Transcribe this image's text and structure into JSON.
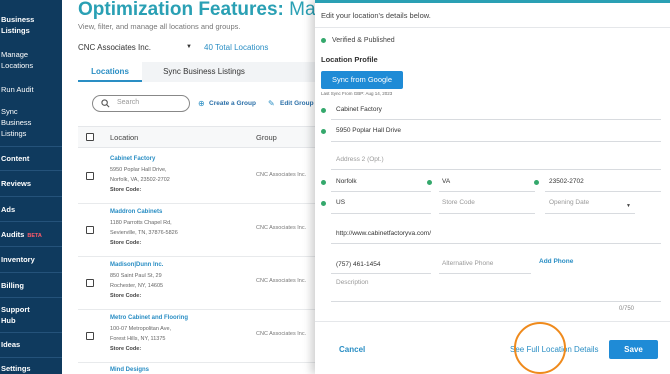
{
  "sidebar": {
    "items": [
      {
        "label": "Business\nListings"
      },
      {
        "label": "Manage\nLocations"
      },
      {
        "label": "Run Audit"
      },
      {
        "label": "Sync\nBusiness\nListings"
      },
      {
        "label": "Content"
      },
      {
        "label": "Reviews"
      },
      {
        "label": "Ads"
      },
      {
        "label": "Audits",
        "badge": "BETA"
      },
      {
        "label": "Inventory"
      },
      {
        "label": "Billing"
      },
      {
        "label": "Support\nHub"
      },
      {
        "label": "Ideas"
      },
      {
        "label": "Settings"
      }
    ]
  },
  "header": {
    "title_bold": "Optimization Features:",
    "title_rest": " Manage",
    "subtitle": "View, filter, and manage all locations and groups.",
    "company": "CNC Associates Inc.",
    "total_locations": "40 Total Locations"
  },
  "tabs": [
    {
      "label": "Locations",
      "active": true
    },
    {
      "label": "Sync Business Listings",
      "active": false
    }
  ],
  "toolbar": {
    "search_placeholder": "Search",
    "create_group": "Create a Group",
    "edit_group": "Edit Group"
  },
  "table": {
    "columns": [
      "Location",
      "Group"
    ],
    "rows": [
      {
        "name": "Cabinet Factory",
        "address1": "5950 Poplar Hall Drive,",
        "address2": "Norfolk, VA, 23502-2702",
        "store_code": "Store Code:",
        "group": "CNC Associates Inc."
      },
      {
        "name": "Maddron Cabinets",
        "address1": "1180 Parrotts Chapel Rd,",
        "address2": "Sevierville, TN, 37876-5826",
        "store_code": "Store Code:",
        "group": "CNC Associates Inc."
      },
      {
        "name": "Madison|Dunn Inc.",
        "address1": "850 Saint Paul St, 29",
        "address2": "Rochester, NY, 14605",
        "store_code": "Store Code:",
        "group": "CNC Associates Inc."
      },
      {
        "name": "Metro Cabinet and Flooring",
        "address1": "100-07 Metropolitan Ave,",
        "address2": "Forest Hills, NY, 11375",
        "store_code": "Store Code:",
        "group": "CNC Associates Inc."
      },
      {
        "name": "Mind Designs"
      }
    ]
  },
  "panel": {
    "intro": "Edit your location's details below.",
    "verified": "Verified & Published",
    "section_title": "Location Profile",
    "sync_button": "Sync from Google",
    "last_sync": "Last Sync From GBP: Aug 14, 2023",
    "fields": {
      "business_name": "Cabinet Factory",
      "address1": "5950 Poplar Hall Drive",
      "address2_placeholder": "Address 2 (Opt.)",
      "city": "Norfolk",
      "state": "VA",
      "zip": "23502-2702",
      "country": "US",
      "store_code_placeholder": "Store Code",
      "opening_date_placeholder": "Opening Date",
      "website": "http://www.cabinetfactoryva.com/",
      "phone": "(757) 461-1454",
      "alt_phone_placeholder": "Alternative Phone",
      "add_phone": "Add Phone",
      "description_placeholder": "Description",
      "char_counter": "0/750"
    },
    "cancel": "Cancel",
    "see_full_details": "See Full Location Details",
    "save": "Save"
  },
  "colors": {
    "sidebar_bg": "#0f3a5e",
    "accent": "#2aa0b4",
    "link": "#2a8ec4",
    "primary_button": "#1f8bd6",
    "verified_green": "#34a86c",
    "highlight_ring": "#ef8a1c"
  }
}
